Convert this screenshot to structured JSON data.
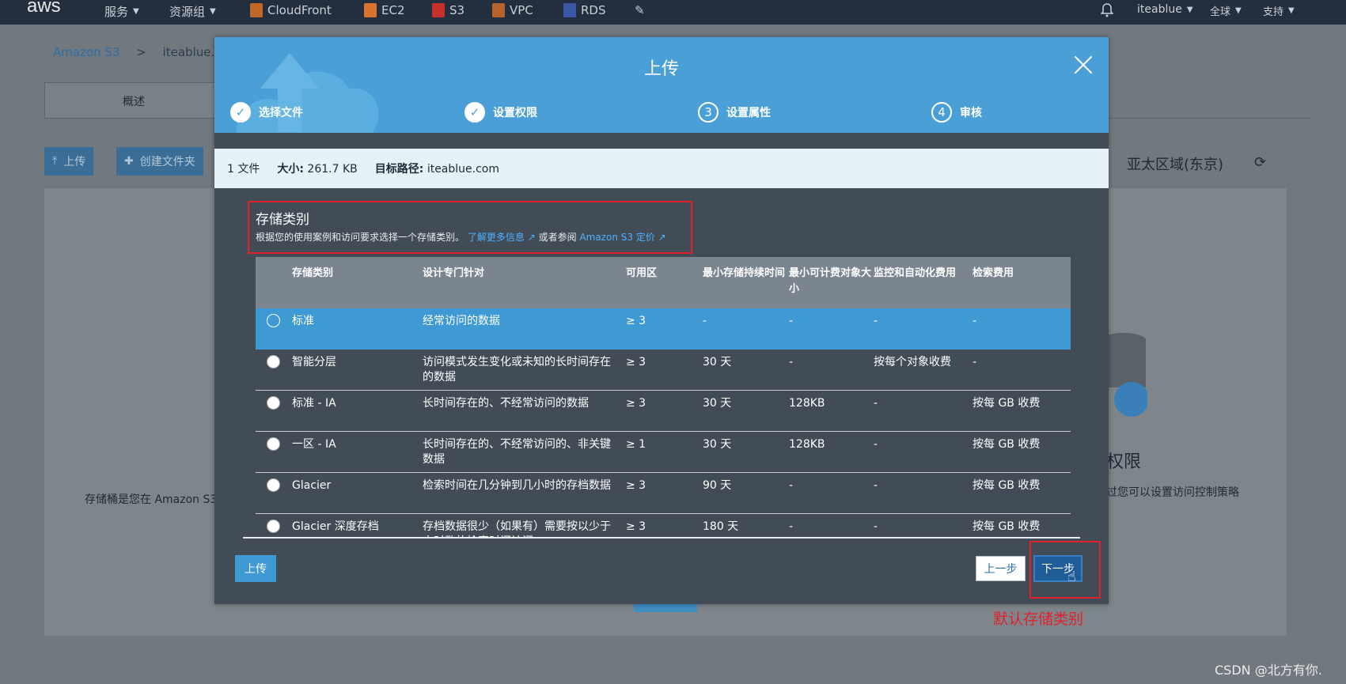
{
  "topnav": {
    "logo": "aws",
    "services": "服务",
    "resource_groups": "资源组",
    "shortcuts": [
      {
        "label": "CloudFront",
        "color": "#c0672a"
      },
      {
        "label": "EC2",
        "color": "#d9742f"
      },
      {
        "label": "S3",
        "color": "#c5312a"
      },
      {
        "label": "VPC",
        "color": "#b7642c"
      },
      {
        "label": "RDS",
        "color": "#3b58a6"
      }
    ],
    "pin_icon": "pin-icon",
    "bell_icon": "bell-icon",
    "account": "iteablue",
    "region": "全球",
    "support": "支持"
  },
  "background": {
    "breadcrumb_root": "Amazon S3",
    "breadcrumb_sep": ">",
    "breadcrumb_bucket": "iteablue.co",
    "tab_overview": "概述",
    "btn_upload": "上传",
    "btn_create_folder": "创建文件夹",
    "region_label": "亚太区域(东京)",
    "left_text": "存储桶是您在 Amazon S3",
    "right_title": "权限",
    "right_text": "过您可以设置访问控制策略"
  },
  "modal": {
    "title": "上传",
    "steps": [
      {
        "label": "选择文件",
        "number": "1",
        "done": true
      },
      {
        "label": "设置权限",
        "number": "2",
        "done": true
      },
      {
        "label": "设置属性",
        "number": "3",
        "done": false
      },
      {
        "label": "审核",
        "number": "4",
        "done": false
      }
    ],
    "summary": {
      "files": "1 文件",
      "size_label": "大小:",
      "size_value": "261.7 KB",
      "target_label": "目标路径:",
      "target_value": "iteablue.com"
    },
    "storage_class": {
      "title": "存储类别",
      "desc": "根据您的使用案例和访问要求选择一个存储类别。",
      "learn_more": "了解更多信息",
      "or_see": "或者参阅",
      "pricing_link": "Amazon S3 定价"
    },
    "table": {
      "headers": [
        "存储类别",
        "设计专门针对",
        "可用区",
        "最小存储持续时间",
        "最小可计费对象大小",
        "监控和自动化费用",
        "检索费用"
      ],
      "rows": [
        {
          "name": "标准",
          "designed": "经常访问的数据",
          "az": "≥ 3",
          "min_duration": "-",
          "min_size": "-",
          "monitoring": "-",
          "retrieval": "-",
          "selected": true
        },
        {
          "name": "智能分层",
          "designed": "访问模式发生变化或未知的长时间存在的数据",
          "az": "≥ 3",
          "min_duration": "30 天",
          "min_size": "-",
          "monitoring": "按每个对象收费",
          "retrieval": "-",
          "selected": false
        },
        {
          "name": "标准 - IA",
          "designed": "长时间存在的、不经常访问的数据",
          "az": "≥ 3",
          "min_duration": "30 天",
          "min_size": "128KB",
          "monitoring": "-",
          "retrieval": "按每 GB 收费",
          "selected": false
        },
        {
          "name": "一区 - IA",
          "designed": "长时间存在的、不经常访问的、非关键数据",
          "az": "≥ 1",
          "min_duration": "30 天",
          "min_size": "128KB",
          "monitoring": "-",
          "retrieval": "按每 GB 收费",
          "selected": false
        },
        {
          "name": "Glacier",
          "designed": "检索时间在几分钟到几小时的存档数据",
          "az": "≥ 3",
          "min_duration": "90 天",
          "min_size": "-",
          "monitoring": "-",
          "retrieval": "按每 GB 收费",
          "selected": false
        },
        {
          "name": "Glacier 深度存档",
          "designed": "存档数据很少（如果有）需要按以少于小时数的检索时间访问",
          "az": "≥ 3",
          "min_duration": "180 天",
          "min_size": "-",
          "monitoring": "-",
          "retrieval": "按每 GB 收费",
          "selected": false
        }
      ]
    },
    "btn_upload": "上传",
    "btn_prev": "上一步",
    "btn_next": "下一步"
  },
  "annotation": "默认存储类别",
  "watermark": "CSDN @北方有你."
}
